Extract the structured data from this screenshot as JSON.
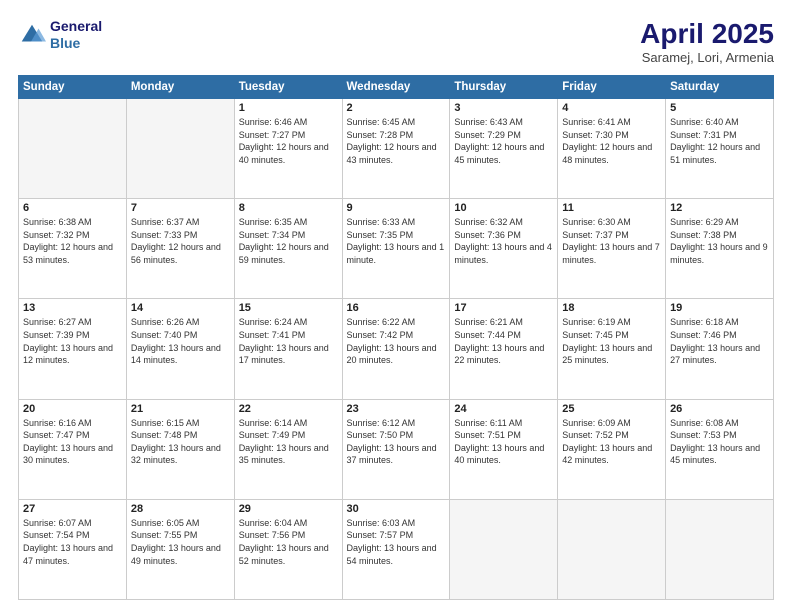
{
  "logo": {
    "line1": "General",
    "line2": "Blue"
  },
  "title": "April 2025",
  "location": "Saramej, Lori, Armenia",
  "weekdays": [
    "Sunday",
    "Monday",
    "Tuesday",
    "Wednesday",
    "Thursday",
    "Friday",
    "Saturday"
  ],
  "weeks": [
    [
      {
        "day": "",
        "sunrise": "",
        "sunset": "",
        "daylight": ""
      },
      {
        "day": "",
        "sunrise": "",
        "sunset": "",
        "daylight": ""
      },
      {
        "day": "1",
        "sunrise": "Sunrise: 6:46 AM",
        "sunset": "Sunset: 7:27 PM",
        "daylight": "Daylight: 12 hours and 40 minutes."
      },
      {
        "day": "2",
        "sunrise": "Sunrise: 6:45 AM",
        "sunset": "Sunset: 7:28 PM",
        "daylight": "Daylight: 12 hours and 43 minutes."
      },
      {
        "day": "3",
        "sunrise": "Sunrise: 6:43 AM",
        "sunset": "Sunset: 7:29 PM",
        "daylight": "Daylight: 12 hours and 45 minutes."
      },
      {
        "day": "4",
        "sunrise": "Sunrise: 6:41 AM",
        "sunset": "Sunset: 7:30 PM",
        "daylight": "Daylight: 12 hours and 48 minutes."
      },
      {
        "day": "5",
        "sunrise": "Sunrise: 6:40 AM",
        "sunset": "Sunset: 7:31 PM",
        "daylight": "Daylight: 12 hours and 51 minutes."
      }
    ],
    [
      {
        "day": "6",
        "sunrise": "Sunrise: 6:38 AM",
        "sunset": "Sunset: 7:32 PM",
        "daylight": "Daylight: 12 hours and 53 minutes."
      },
      {
        "day": "7",
        "sunrise": "Sunrise: 6:37 AM",
        "sunset": "Sunset: 7:33 PM",
        "daylight": "Daylight: 12 hours and 56 minutes."
      },
      {
        "day": "8",
        "sunrise": "Sunrise: 6:35 AM",
        "sunset": "Sunset: 7:34 PM",
        "daylight": "Daylight: 12 hours and 59 minutes."
      },
      {
        "day": "9",
        "sunrise": "Sunrise: 6:33 AM",
        "sunset": "Sunset: 7:35 PM",
        "daylight": "Daylight: 13 hours and 1 minute."
      },
      {
        "day": "10",
        "sunrise": "Sunrise: 6:32 AM",
        "sunset": "Sunset: 7:36 PM",
        "daylight": "Daylight: 13 hours and 4 minutes."
      },
      {
        "day": "11",
        "sunrise": "Sunrise: 6:30 AM",
        "sunset": "Sunset: 7:37 PM",
        "daylight": "Daylight: 13 hours and 7 minutes."
      },
      {
        "day": "12",
        "sunrise": "Sunrise: 6:29 AM",
        "sunset": "Sunset: 7:38 PM",
        "daylight": "Daylight: 13 hours and 9 minutes."
      }
    ],
    [
      {
        "day": "13",
        "sunrise": "Sunrise: 6:27 AM",
        "sunset": "Sunset: 7:39 PM",
        "daylight": "Daylight: 13 hours and 12 minutes."
      },
      {
        "day": "14",
        "sunrise": "Sunrise: 6:26 AM",
        "sunset": "Sunset: 7:40 PM",
        "daylight": "Daylight: 13 hours and 14 minutes."
      },
      {
        "day": "15",
        "sunrise": "Sunrise: 6:24 AM",
        "sunset": "Sunset: 7:41 PM",
        "daylight": "Daylight: 13 hours and 17 minutes."
      },
      {
        "day": "16",
        "sunrise": "Sunrise: 6:22 AM",
        "sunset": "Sunset: 7:42 PM",
        "daylight": "Daylight: 13 hours and 20 minutes."
      },
      {
        "day": "17",
        "sunrise": "Sunrise: 6:21 AM",
        "sunset": "Sunset: 7:44 PM",
        "daylight": "Daylight: 13 hours and 22 minutes."
      },
      {
        "day": "18",
        "sunrise": "Sunrise: 6:19 AM",
        "sunset": "Sunset: 7:45 PM",
        "daylight": "Daylight: 13 hours and 25 minutes."
      },
      {
        "day": "19",
        "sunrise": "Sunrise: 6:18 AM",
        "sunset": "Sunset: 7:46 PM",
        "daylight": "Daylight: 13 hours and 27 minutes."
      }
    ],
    [
      {
        "day": "20",
        "sunrise": "Sunrise: 6:16 AM",
        "sunset": "Sunset: 7:47 PM",
        "daylight": "Daylight: 13 hours and 30 minutes."
      },
      {
        "day": "21",
        "sunrise": "Sunrise: 6:15 AM",
        "sunset": "Sunset: 7:48 PM",
        "daylight": "Daylight: 13 hours and 32 minutes."
      },
      {
        "day": "22",
        "sunrise": "Sunrise: 6:14 AM",
        "sunset": "Sunset: 7:49 PM",
        "daylight": "Daylight: 13 hours and 35 minutes."
      },
      {
        "day": "23",
        "sunrise": "Sunrise: 6:12 AM",
        "sunset": "Sunset: 7:50 PM",
        "daylight": "Daylight: 13 hours and 37 minutes."
      },
      {
        "day": "24",
        "sunrise": "Sunrise: 6:11 AM",
        "sunset": "Sunset: 7:51 PM",
        "daylight": "Daylight: 13 hours and 40 minutes."
      },
      {
        "day": "25",
        "sunrise": "Sunrise: 6:09 AM",
        "sunset": "Sunset: 7:52 PM",
        "daylight": "Daylight: 13 hours and 42 minutes."
      },
      {
        "day": "26",
        "sunrise": "Sunrise: 6:08 AM",
        "sunset": "Sunset: 7:53 PM",
        "daylight": "Daylight: 13 hours and 45 minutes."
      }
    ],
    [
      {
        "day": "27",
        "sunrise": "Sunrise: 6:07 AM",
        "sunset": "Sunset: 7:54 PM",
        "daylight": "Daylight: 13 hours and 47 minutes."
      },
      {
        "day": "28",
        "sunrise": "Sunrise: 6:05 AM",
        "sunset": "Sunset: 7:55 PM",
        "daylight": "Daylight: 13 hours and 49 minutes."
      },
      {
        "day": "29",
        "sunrise": "Sunrise: 6:04 AM",
        "sunset": "Sunset: 7:56 PM",
        "daylight": "Daylight: 13 hours and 52 minutes."
      },
      {
        "day": "30",
        "sunrise": "Sunrise: 6:03 AM",
        "sunset": "Sunset: 7:57 PM",
        "daylight": "Daylight: 13 hours and 54 minutes."
      },
      {
        "day": "",
        "sunrise": "",
        "sunset": "",
        "daylight": ""
      },
      {
        "day": "",
        "sunrise": "",
        "sunset": "",
        "daylight": ""
      },
      {
        "day": "",
        "sunrise": "",
        "sunset": "",
        "daylight": ""
      }
    ]
  ]
}
